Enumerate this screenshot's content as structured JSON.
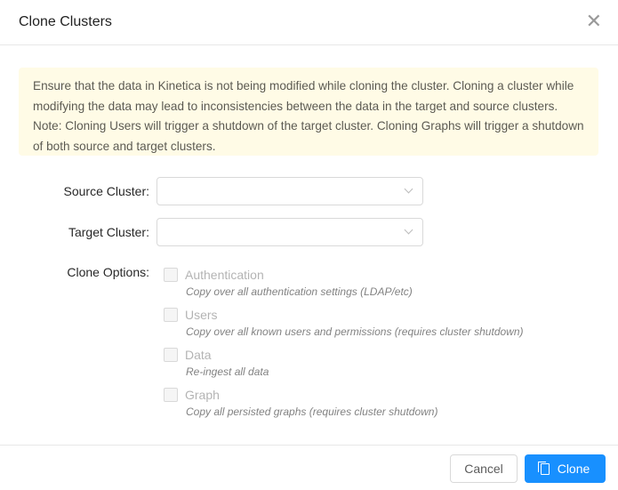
{
  "dialog": {
    "title": "Clone Clusters",
    "close_icon": "close-icon"
  },
  "alert": {
    "text": "Ensure that the data in Kinetica is not being modified while cloning the cluster. Cloning a cluster while modifying the data may lead to inconsistencies between the data in the target and source clusters. Note: Cloning Users will trigger a shutdown of the target cluster. Cloning Graphs will trigger a shutdown of both source and target clusters."
  },
  "form": {
    "source_label": "Source Cluster",
    "target_label": "Target Cluster",
    "options_label": "Clone Options",
    "source_value": "",
    "target_value": "",
    "options": [
      {
        "label": "Authentication",
        "description": "Copy over all authentication settings (LDAP/etc)",
        "checked": false,
        "disabled": true
      },
      {
        "label": "Users",
        "description": "Copy over all known users and permissions (requires cluster shutdown)",
        "checked": false,
        "disabled": true
      },
      {
        "label": "Data",
        "description": "Re-ingest all data",
        "checked": false,
        "disabled": true
      },
      {
        "label": "Graph",
        "description": "Copy all persisted graphs (requires cluster shutdown)",
        "checked": false,
        "disabled": true
      }
    ]
  },
  "footer": {
    "cancel_label": "Cancel",
    "clone_label": "Clone",
    "accent": "#1890ff"
  }
}
